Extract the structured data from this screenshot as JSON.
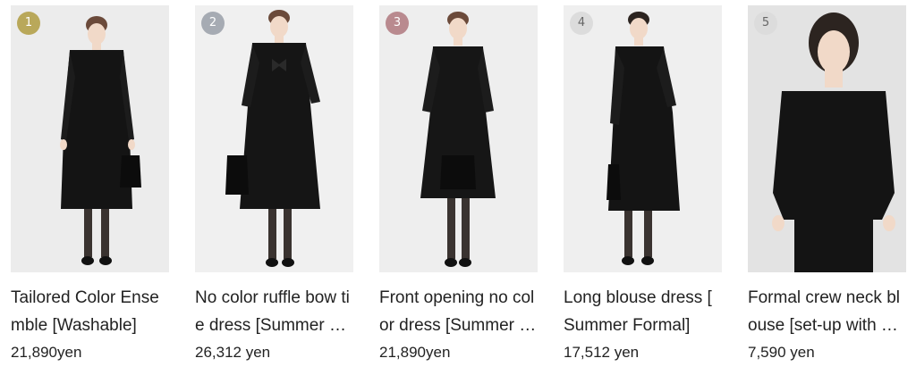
{
  "products": [
    {
      "rank": "1",
      "rank_color": "#b9a85a",
      "title": "Tailored Color Ensemble [Washable]",
      "price": "21,890yen",
      "bg": "#ececec",
      "figure": "jacket-dress"
    },
    {
      "rank": "2",
      "rank_color": "#a6abb3",
      "title": "No color ruffle bow tie dress [Summer Formal]",
      "price": "26,312 yen",
      "bg": "#f0f0f0",
      "figure": "bolero-dress"
    },
    {
      "rank": "3",
      "rank_color": "#b98a8f",
      "title": "Front opening no color dress [Summer Formal]",
      "price": "21,890yen",
      "bg": "#eeeeee",
      "figure": "a-line-dress"
    },
    {
      "rank": "4",
      "rank_color": "#dcdcdc",
      "title": "Long blouse dress [ Summer Formal]",
      "price": "17,512 yen",
      "bg": "#efefef",
      "figure": "long-blouse"
    },
    {
      "rank": "5",
      "rank_color": "#dcdcdc",
      "title": "Formal crew neck blouse [set-up with pants]",
      "price": "7,590 yen",
      "bg": "#e6e6e6",
      "figure": "crew-blouse"
    }
  ]
}
